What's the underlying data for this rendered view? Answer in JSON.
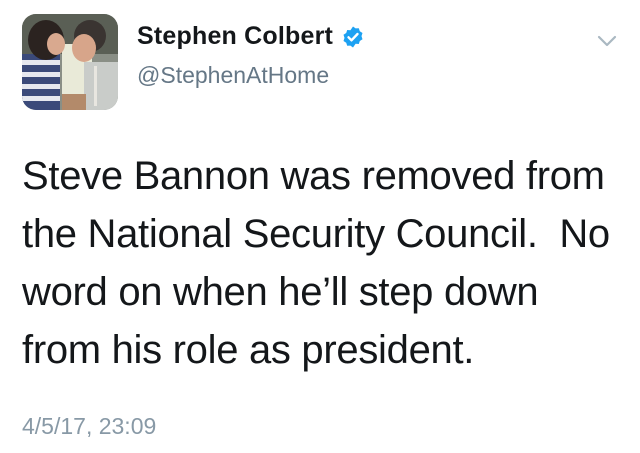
{
  "author": {
    "display_name": "Stephen Colbert",
    "handle": "@StephenAtHome",
    "verified": true,
    "avatar_icon": "profile-photo"
  },
  "tweet": {
    "text": "Steve Bannon was removed from\nthe National Security Council.  No\nword on when he’ll step down\nfrom his role as president.",
    "timestamp": "4/5/17, 23:09"
  },
  "colors": {
    "verified_badge": "#1da1f2",
    "secondary_text": "#657786",
    "timestamp_text": "#8899a6",
    "caret": "#aab8c2"
  }
}
